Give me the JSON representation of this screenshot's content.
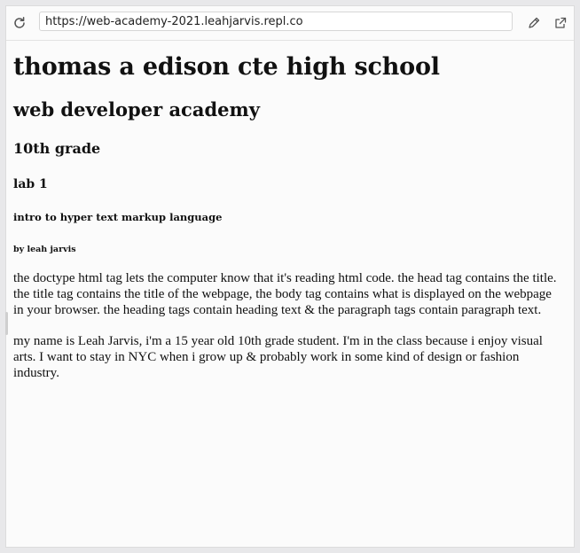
{
  "toolbar": {
    "url": "https://web-academy-2021.leahjarvis.repl.co",
    "icons": [
      "reload-icon",
      "edit-icon",
      "open-external-icon"
    ]
  },
  "page": {
    "h1": "thomas a edison cte high school",
    "h2": "web developer academy",
    "h3": "10th grade",
    "h4": "lab 1",
    "h5": "intro to hyper text markup language",
    "h6": "by leah jarvis",
    "paragraphs": [
      "the doctype html tag lets the computer know that it's reading html code. the head tag contains the title. the title tag contains the title of the webpage, the body tag contains what is displayed on the webpage in your browser. the heading tags contain heading text & the paragraph tags contain paragraph text.",
      "my name is Leah Jarvis, i'm a 15 year old 10th grade student. I'm in the class because i enjoy visual arts. I want to stay in NYC when i grow up & probably work in some kind of design or fashion industry."
    ]
  },
  "colors": {
    "background": "#fbfbfb",
    "outer": "#e8e8ea",
    "text": "#111111"
  }
}
